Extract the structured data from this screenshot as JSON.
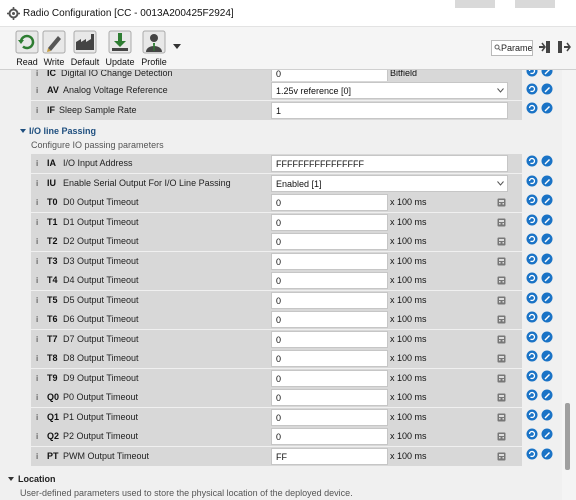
{
  "window": {
    "title": "Radio Configuration [CC - 0013A200425F2924]"
  },
  "toolbar": {
    "buttons": [
      {
        "label": "Read",
        "icon": "read-icon"
      },
      {
        "label": "Write",
        "icon": "write-icon"
      },
      {
        "label": "Default",
        "icon": "default-icon"
      },
      {
        "label": "Update",
        "icon": "update-icon"
      },
      {
        "label": "Profile",
        "icon": "profile-icon"
      }
    ],
    "search_value": "Parameter"
  },
  "colors": {
    "accent_blue": "#1a73c6",
    "row_bg": "#d8d8d8",
    "section_head": "#1f4f7f"
  },
  "top_rows": {
    "partial": {
      "code": "IC",
      "name": "Digital IO Change Detection",
      "value": "0",
      "unit": "Bitfield"
    },
    "av": {
      "code": "AV",
      "name": "Analog Voltage Reference",
      "value": "1.25v reference [0]"
    },
    "if": {
      "code": "IF",
      "name": "Sleep Sample Rate",
      "value": "1"
    }
  },
  "io_section": {
    "title": "I/O line Passing",
    "description": "Configure IO passing parameters",
    "rows": [
      {
        "code": "IA",
        "name": "I/O Input Address",
        "value": "FFFFFFFFFFFFFFFF",
        "kind": "text",
        "unit": ""
      },
      {
        "code": "IU",
        "name": "Enable Serial Output For I/O Line Passing",
        "value": "Enabled [1]",
        "kind": "select",
        "unit": ""
      },
      {
        "code": "T0",
        "name": "D0 Output Timeout",
        "value": "0",
        "kind": "num",
        "unit": "x 100 ms"
      },
      {
        "code": "T1",
        "name": "D1 Output Timeout",
        "value": "0",
        "kind": "num",
        "unit": "x 100 ms"
      },
      {
        "code": "T2",
        "name": "D2 Output Timeout",
        "value": "0",
        "kind": "num",
        "unit": "x 100 ms"
      },
      {
        "code": "T3",
        "name": "D3 Output Timeout",
        "value": "0",
        "kind": "num",
        "unit": "x 100 ms"
      },
      {
        "code": "T4",
        "name": "D4 Output Timeout",
        "value": "0",
        "kind": "num",
        "unit": "x 100 ms"
      },
      {
        "code": "T5",
        "name": "D5 Output Timeout",
        "value": "0",
        "kind": "num",
        "unit": "x 100 ms"
      },
      {
        "code": "T6",
        "name": "D6 Output Timeout",
        "value": "0",
        "kind": "num",
        "unit": "x 100 ms"
      },
      {
        "code": "T7",
        "name": "D7 Output Timeout",
        "value": "0",
        "kind": "num",
        "unit": "x 100 ms"
      },
      {
        "code": "T8",
        "name": "D8 Output Timeout",
        "value": "0",
        "kind": "num",
        "unit": "x 100 ms"
      },
      {
        "code": "T9",
        "name": "D9 Output Timeout",
        "value": "0",
        "kind": "num",
        "unit": "x 100 ms"
      },
      {
        "code": "Q0",
        "name": "P0 Output Timeout",
        "value": "0",
        "kind": "num",
        "unit": "x 100 ms"
      },
      {
        "code": "Q1",
        "name": "P1 Output Timeout",
        "value": "0",
        "kind": "num",
        "unit": "x 100 ms"
      },
      {
        "code": "Q2",
        "name": "P2 Output Timeout",
        "value": "0",
        "kind": "num",
        "unit": "x 100 ms"
      },
      {
        "code": "PT",
        "name": "PWM Output Timeout",
        "value": "FF",
        "kind": "num",
        "unit": "x 100 ms"
      }
    ]
  },
  "location_section": {
    "title": "Location",
    "description": "User-defined parameters used to store the physical location of the deployed device."
  }
}
